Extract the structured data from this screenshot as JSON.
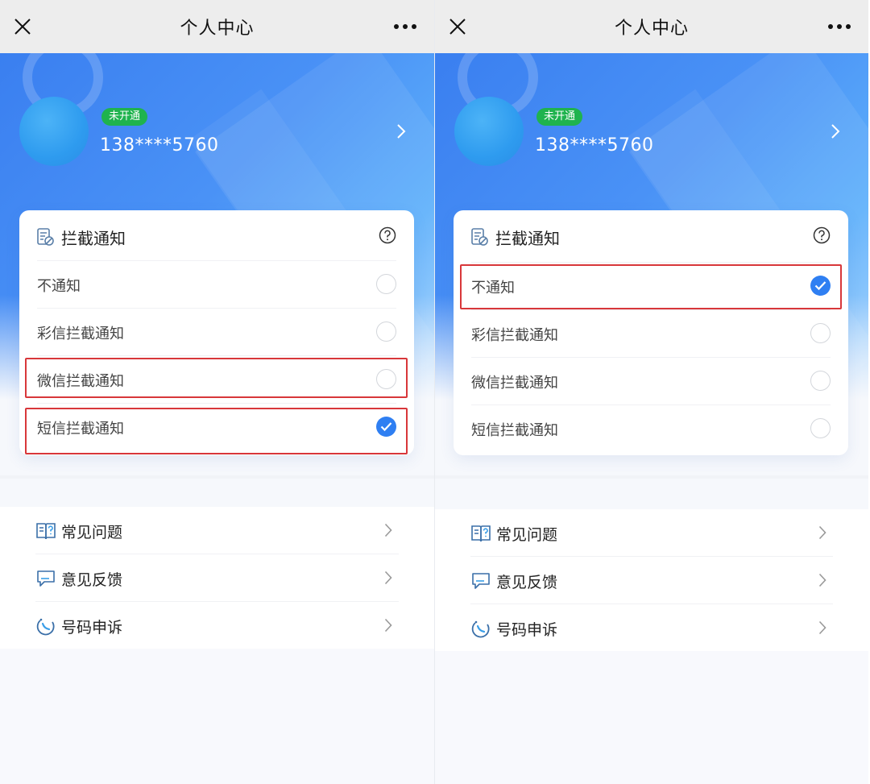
{
  "colors": {
    "accent": "#2f7ff2",
    "badge": "#1fb34e",
    "highlight": "#d8373a",
    "banner_start": "#3a7ff0",
    "banner_end": "#a8d4fd"
  },
  "screens": [
    {
      "nav": {
        "title": "个人中心",
        "close_icon": "close-icon",
        "more_icon": "more-icon"
      },
      "profile": {
        "status_badge": "未开通",
        "phone": "138****5760"
      },
      "card": {
        "title": "拦截通知",
        "options": [
          {
            "label": "不通知",
            "checked": false
          },
          {
            "label": "彩信拦截通知",
            "checked": false
          },
          {
            "label": "微信拦截通知",
            "checked": false
          },
          {
            "label": "短信拦截通知",
            "checked": true
          }
        ]
      },
      "menu": [
        {
          "label": "常见问题",
          "icon": "book-question-icon"
        },
        {
          "label": "意见反馈",
          "icon": "chat-bubble-icon"
        },
        {
          "label": "号码申诉",
          "icon": "phone-appeal-icon"
        }
      ]
    },
    {
      "nav": {
        "title": "个人中心",
        "close_icon": "close-icon",
        "more_icon": "more-icon"
      },
      "profile": {
        "status_badge": "未开通",
        "phone": "138****5760"
      },
      "card": {
        "title": "拦截通知",
        "options": [
          {
            "label": "不通知",
            "checked": true
          },
          {
            "label": "彩信拦截通知",
            "checked": false
          },
          {
            "label": "微信拦截通知",
            "checked": false
          },
          {
            "label": "短信拦截通知",
            "checked": false
          }
        ]
      },
      "menu": [
        {
          "label": "常见问题",
          "icon": "book-question-icon"
        },
        {
          "label": "意见反馈",
          "icon": "chat-bubble-icon"
        },
        {
          "label": "号码申诉",
          "icon": "phone-appeal-icon"
        }
      ]
    }
  ]
}
